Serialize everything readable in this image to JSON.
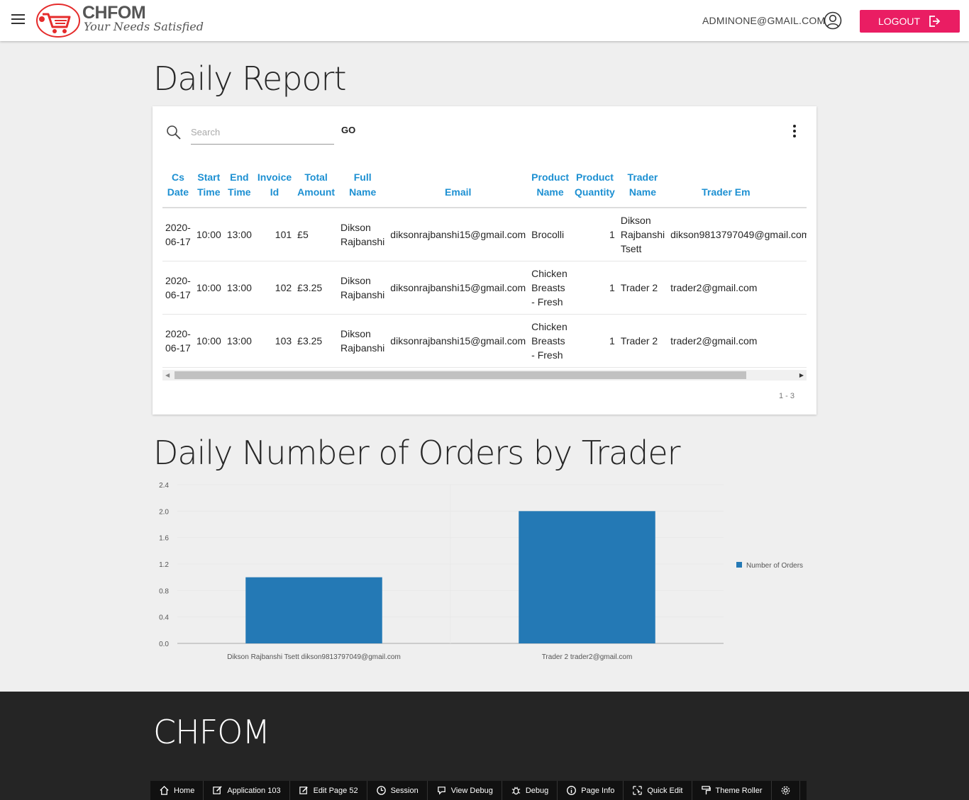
{
  "header": {
    "logo_title": "CHFOM",
    "logo_tagline": "Your Needs Satisfied",
    "user_email": "ADMINONE@GMAIL.COM",
    "logout_label": "LOGOUT"
  },
  "page_title": "Daily Report",
  "search": {
    "placeholder": "Search",
    "go_label": "GO"
  },
  "table": {
    "columns": [
      "Cs Date",
      "Start Time",
      "End Time",
      "Invoice Id",
      "Total Amount",
      "Full Name",
      "Email",
      "Product Name",
      "Product Quantity",
      "Trader Name",
      "Trader Em"
    ],
    "rows": [
      [
        "2020-06-17",
        "10:00",
        "13:00",
        "101",
        "£5",
        "Dikson Rajbanshi",
        "diksonrajbanshi15@gmail.com",
        "Brocolli",
        "1",
        "Dikson Rajbanshi Tsett",
        "dikson9813797049@gmail.com"
      ],
      [
        "2020-06-17",
        "10:00",
        "13:00",
        "102",
        "£3.25",
        "Dikson Rajbanshi",
        "diksonrajbanshi15@gmail.com",
        "Chicken Breasts - Fresh",
        "1",
        "Trader 2",
        "trader2@gmail.com"
      ],
      [
        "2020-06-17",
        "10:00",
        "13:00",
        "103",
        "£3.25",
        "Dikson Rajbanshi",
        "diksonrajbanshi15@gmail.com",
        "Chicken Breasts - Fresh",
        "1",
        "Trader 2",
        "trader2@gmail.com"
      ]
    ],
    "pagination": "1 - 3"
  },
  "chart_title": "Daily Number of Orders by Trader",
  "chart_data": {
    "type": "bar",
    "categories": [
      "Dikson Rajbanshi Tsett dikson9813797049@gmail.com",
      "Trader 2 trader2@gmail.com"
    ],
    "series": [
      {
        "name": "Number of Orders",
        "values": [
          1,
          2
        ],
        "color": "#2479b5"
      }
    ],
    "yticks": [
      "0.0",
      "0.4",
      "0.8",
      "1.2",
      "1.6",
      "2.0",
      "2.4"
    ],
    "ylim": [
      0,
      2.4
    ],
    "legend": "right",
    "grid": true
  },
  "footer": {
    "brand": "CHFOM",
    "devbar": [
      {
        "label": "Home",
        "icon": "home-icon"
      },
      {
        "label": "Application 103",
        "icon": "edit-app-icon"
      },
      {
        "label": "Edit Page 52",
        "icon": "edit-page-icon"
      },
      {
        "label": "Session",
        "icon": "clock-icon"
      },
      {
        "label": "View Debug",
        "icon": "view-debug-icon"
      },
      {
        "label": "Debug",
        "icon": "bug-icon"
      },
      {
        "label": "Page Info",
        "icon": "info-icon"
      },
      {
        "label": "Quick Edit",
        "icon": "quick-edit-icon"
      },
      {
        "label": "Theme Roller",
        "icon": "paint-roller-icon"
      },
      {
        "label": "",
        "icon": "gear-icon"
      }
    ]
  }
}
